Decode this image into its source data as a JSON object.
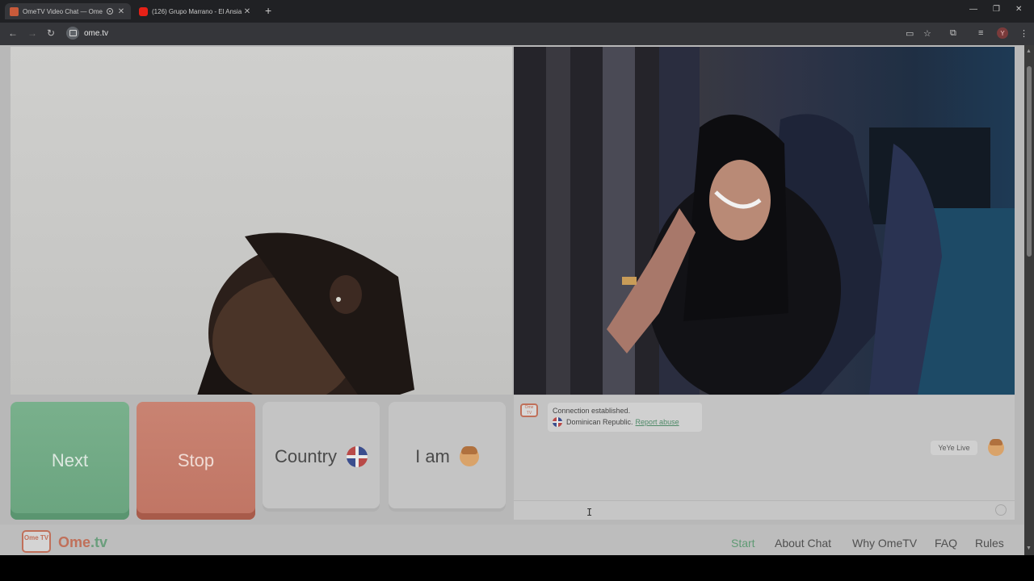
{
  "browser": {
    "tabs": [
      {
        "title": "OmeTV Video Chat — Ome",
        "active": true
      },
      {
        "title": "(126) Grupo Marrano - El Ansia",
        "active": false
      }
    ],
    "new_tab": "+",
    "window_controls": {
      "minimize": "—",
      "restore": "❐",
      "close": "✕"
    },
    "nav": {
      "back": "←",
      "forward": "→",
      "reload": "↻"
    },
    "url": "ome.tv",
    "profile_initial": "Y"
  },
  "controls": {
    "next_label": "Next",
    "stop_label": "Stop",
    "country_label": "Country",
    "iam_label": "I am"
  },
  "chat": {
    "logo_text": "Ome TV",
    "status": "Connection established.",
    "country": "Dominican Republic.",
    "report_label": "Report abuse",
    "self_message": "YeYe Live"
  },
  "footer": {
    "logo_prefix": "Ome",
    "logo_suffix": ".tv",
    "logo_box": "Ome TV",
    "nav": [
      "Start",
      "About Chat",
      "Why OmeTV",
      "FAQ",
      "Rules"
    ]
  },
  "colors": {
    "next": "#6aa47f",
    "stop": "#c07564",
    "accent_green": "#5f9a74",
    "brand_orange": "#c0705a"
  }
}
